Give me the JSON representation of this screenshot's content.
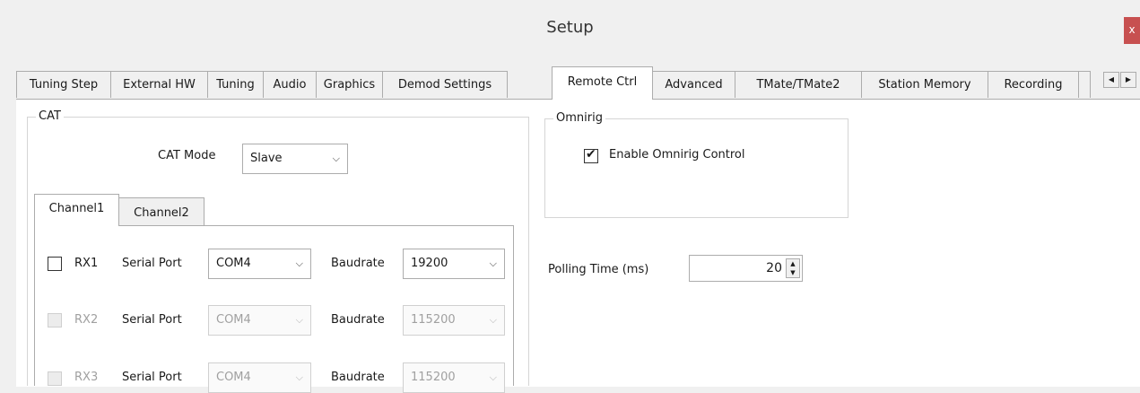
{
  "window": {
    "title": "Setup",
    "close_glyph": "x"
  },
  "tabs": [
    {
      "label": "Tuning Step"
    },
    {
      "label": "External HW"
    },
    {
      "label": "Tuning"
    },
    {
      "label": "Audio"
    },
    {
      "label": "Graphics"
    },
    {
      "label": "Demod Settings"
    },
    {
      "label": "Remote Ctrl"
    },
    {
      "label": "Advanced"
    },
    {
      "label": "TMate/TMate2"
    },
    {
      "label": "Station Memory"
    },
    {
      "label": "Recording"
    }
  ],
  "active_tab": "Remote Ctrl",
  "tab_scroll": {
    "left_icon": "triangle-left",
    "right_icon": "triangle-right"
  },
  "cat": {
    "group_label": "CAT",
    "mode_label": "CAT Mode",
    "mode_value": "Slave",
    "channel_tabs": [
      "Channel1",
      "Channel2"
    ],
    "rows": [
      {
        "rx": "RX1",
        "checked": false,
        "enabled": true,
        "serial_label": "Serial Port",
        "port": "COM4",
        "baud_label": "Baudrate",
        "baud": "19200"
      },
      {
        "rx": "RX2",
        "checked": false,
        "enabled": false,
        "serial_label": "Serial Port",
        "port": "COM4",
        "baud_label": "Baudrate",
        "baud": "115200"
      },
      {
        "rx": "RX3",
        "checked": false,
        "enabled": false,
        "serial_label": "Serial Port",
        "port": "COM4",
        "baud_label": "Baudrate",
        "baud": "115200"
      }
    ]
  },
  "omnirig": {
    "group_label": "Omnirig",
    "enable_label": "Enable Omnirig Control",
    "enable_checked": true,
    "check_glyph": "✔"
  },
  "polling": {
    "label": "Polling Time (ms)",
    "value": "20"
  },
  "glyphs": {
    "down": "⌵",
    "spin_up": "▲",
    "spin_down": "▼",
    "left": "◀",
    "right": "▶"
  },
  "colors": {
    "close_bg": "#c75050",
    "active_tab_bg": "#ffffff"
  }
}
